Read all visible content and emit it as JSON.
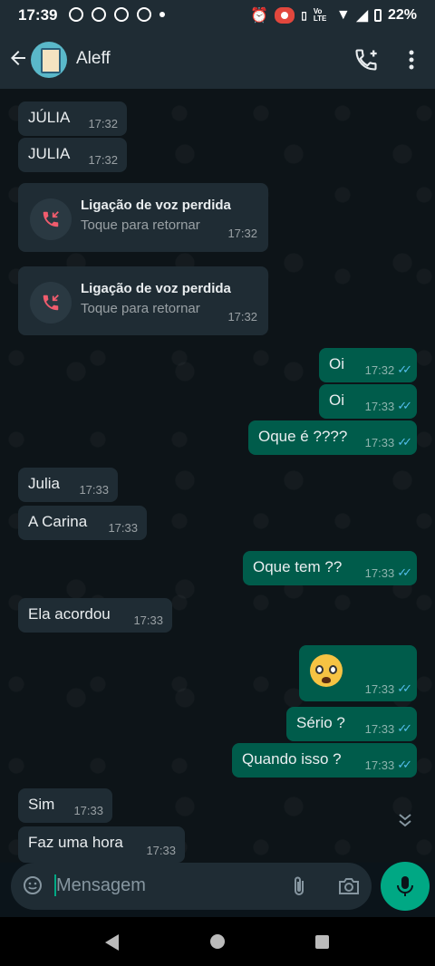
{
  "status_bar": {
    "time": "17:39",
    "volte": "Vo LTE",
    "battery": "22%"
  },
  "header": {
    "contact_name": "Aleff"
  },
  "messages": [
    {
      "text": "JÚLIA",
      "time": "17:32"
    },
    {
      "text": "JULIA",
      "time": "17:32"
    },
    {
      "text": "Oi",
      "time": "17:32"
    },
    {
      "text": "Oi",
      "time": "17:33"
    },
    {
      "text": "Oque é ????",
      "time": "17:33"
    },
    {
      "text": "Julia",
      "time": "17:33"
    },
    {
      "text": "A Carina",
      "time": "17:33"
    },
    {
      "text": "Oque tem ??",
      "time": "17:33"
    },
    {
      "text": "Ela acordou",
      "time": "17:33"
    },
    {
      "text": "😨",
      "time": "17:33"
    },
    {
      "text": "Sério ?",
      "time": "17:33"
    },
    {
      "text": "Quando isso ?",
      "time": "17:33"
    },
    {
      "text": "Sim",
      "time": "17:33"
    },
    {
      "text": "Faz uma hora",
      "time": "17:33"
    }
  ],
  "missed_calls": [
    {
      "title": "Ligação de voz perdida",
      "subtitle": "Toque para retornar",
      "time": "17:32"
    },
    {
      "title": "Ligação de voz perdida",
      "subtitle": "Toque para retornar",
      "time": "17:32"
    }
  ],
  "input": {
    "placeholder": "Mensagem"
  },
  "colors": {
    "accent": "#00a884",
    "outgoing_bubble": "#005c4b",
    "incoming_bubble": "#1f2c34",
    "read_tick": "#53bdeb",
    "missed_call": "#f15c6d"
  },
  "icons": [
    "back-arrow-icon",
    "add-call-icon",
    "more-vert-icon",
    "missed-call-icon",
    "read-ticks-icon",
    "scroll-down-icon",
    "emoji-icon",
    "attach-icon",
    "camera-icon",
    "mic-icon"
  ]
}
